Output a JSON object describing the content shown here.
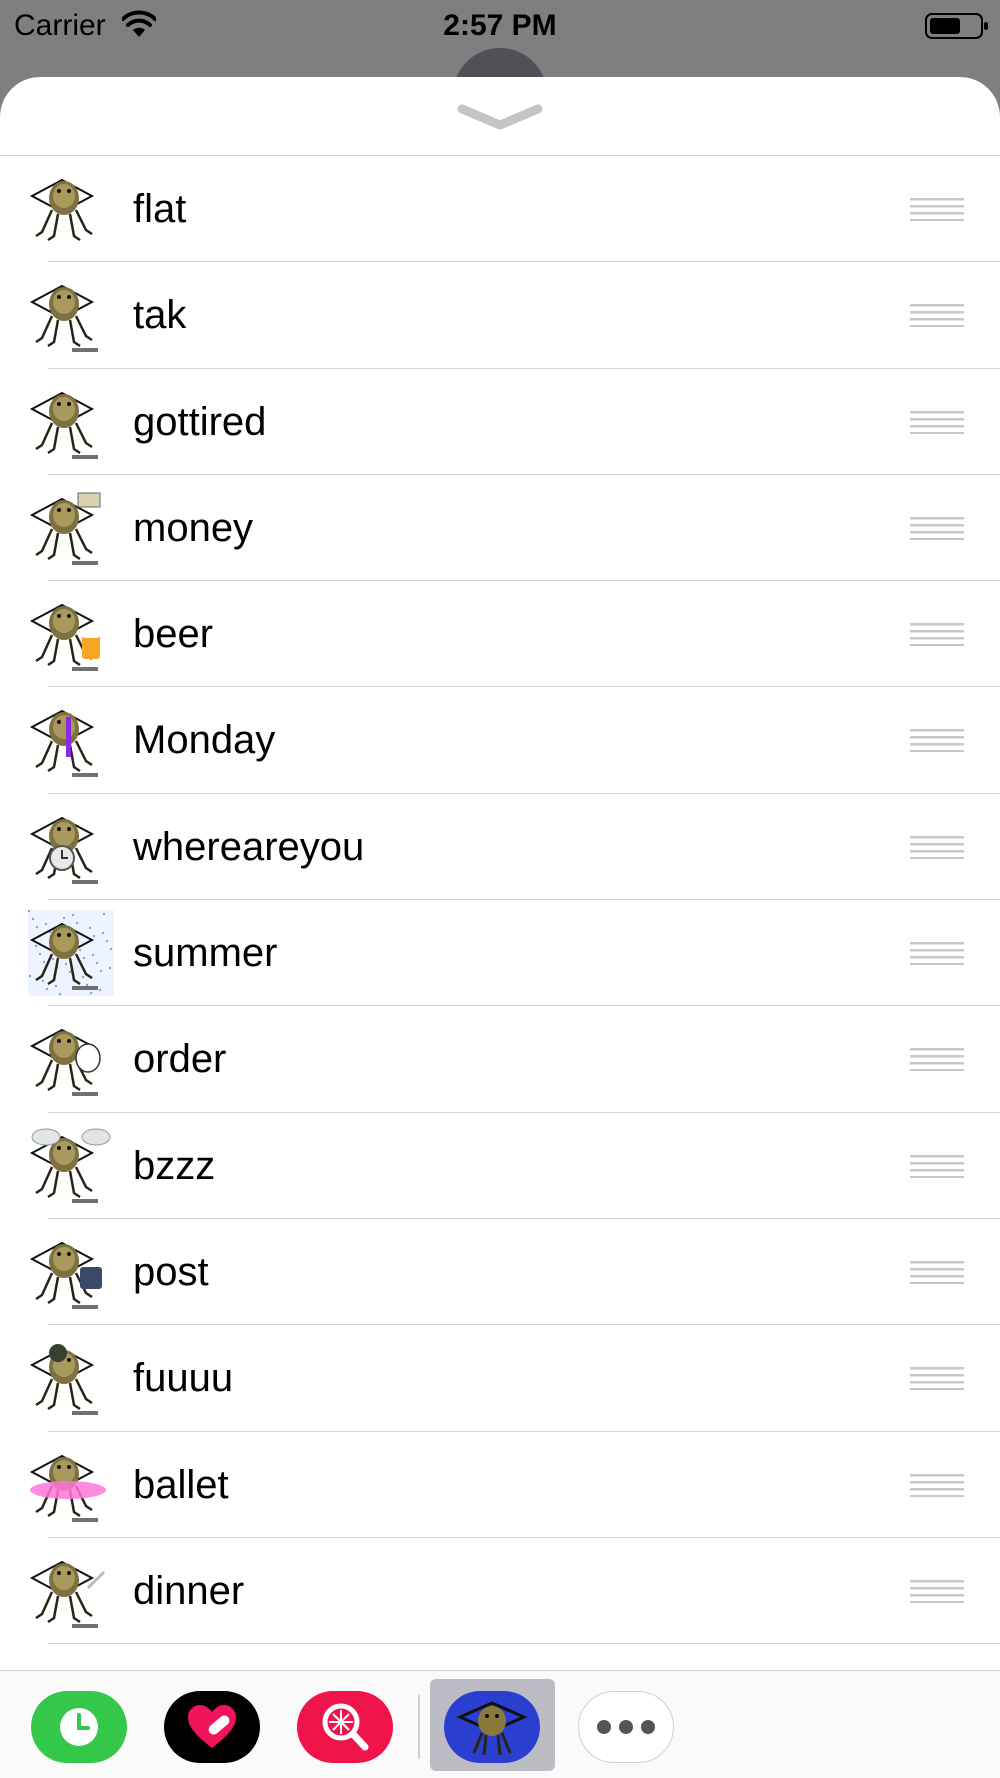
{
  "status_bar": {
    "carrier": "Carrier",
    "time": "2:57 PM"
  },
  "sheet": {
    "items": [
      {
        "label": "flat"
      },
      {
        "label": "tak"
      },
      {
        "label": "gottired"
      },
      {
        "label": "money"
      },
      {
        "label": "beer"
      },
      {
        "label": "Monday"
      },
      {
        "label": "whereareyou"
      },
      {
        "label": "summer"
      },
      {
        "label": "order"
      },
      {
        "label": "bzzz"
      },
      {
        "label": "post"
      },
      {
        "label": "fuuuu"
      },
      {
        "label": "ballet"
      },
      {
        "label": "dinner"
      }
    ]
  },
  "icons": {
    "grabber": "chevron-down-icon",
    "reorder": "reorder-handle-icon",
    "apps": [
      "recents-clock-icon",
      "digital-touch-heart-icon",
      "image-search-icon",
      "bug-sticker-app-icon",
      "more-ellipsis-icon"
    ]
  },
  "colors": {
    "recents": "#34c74a",
    "heart_app": "#000000",
    "search_app": "#f0144a",
    "sticker_app": "#2a3fd0"
  }
}
